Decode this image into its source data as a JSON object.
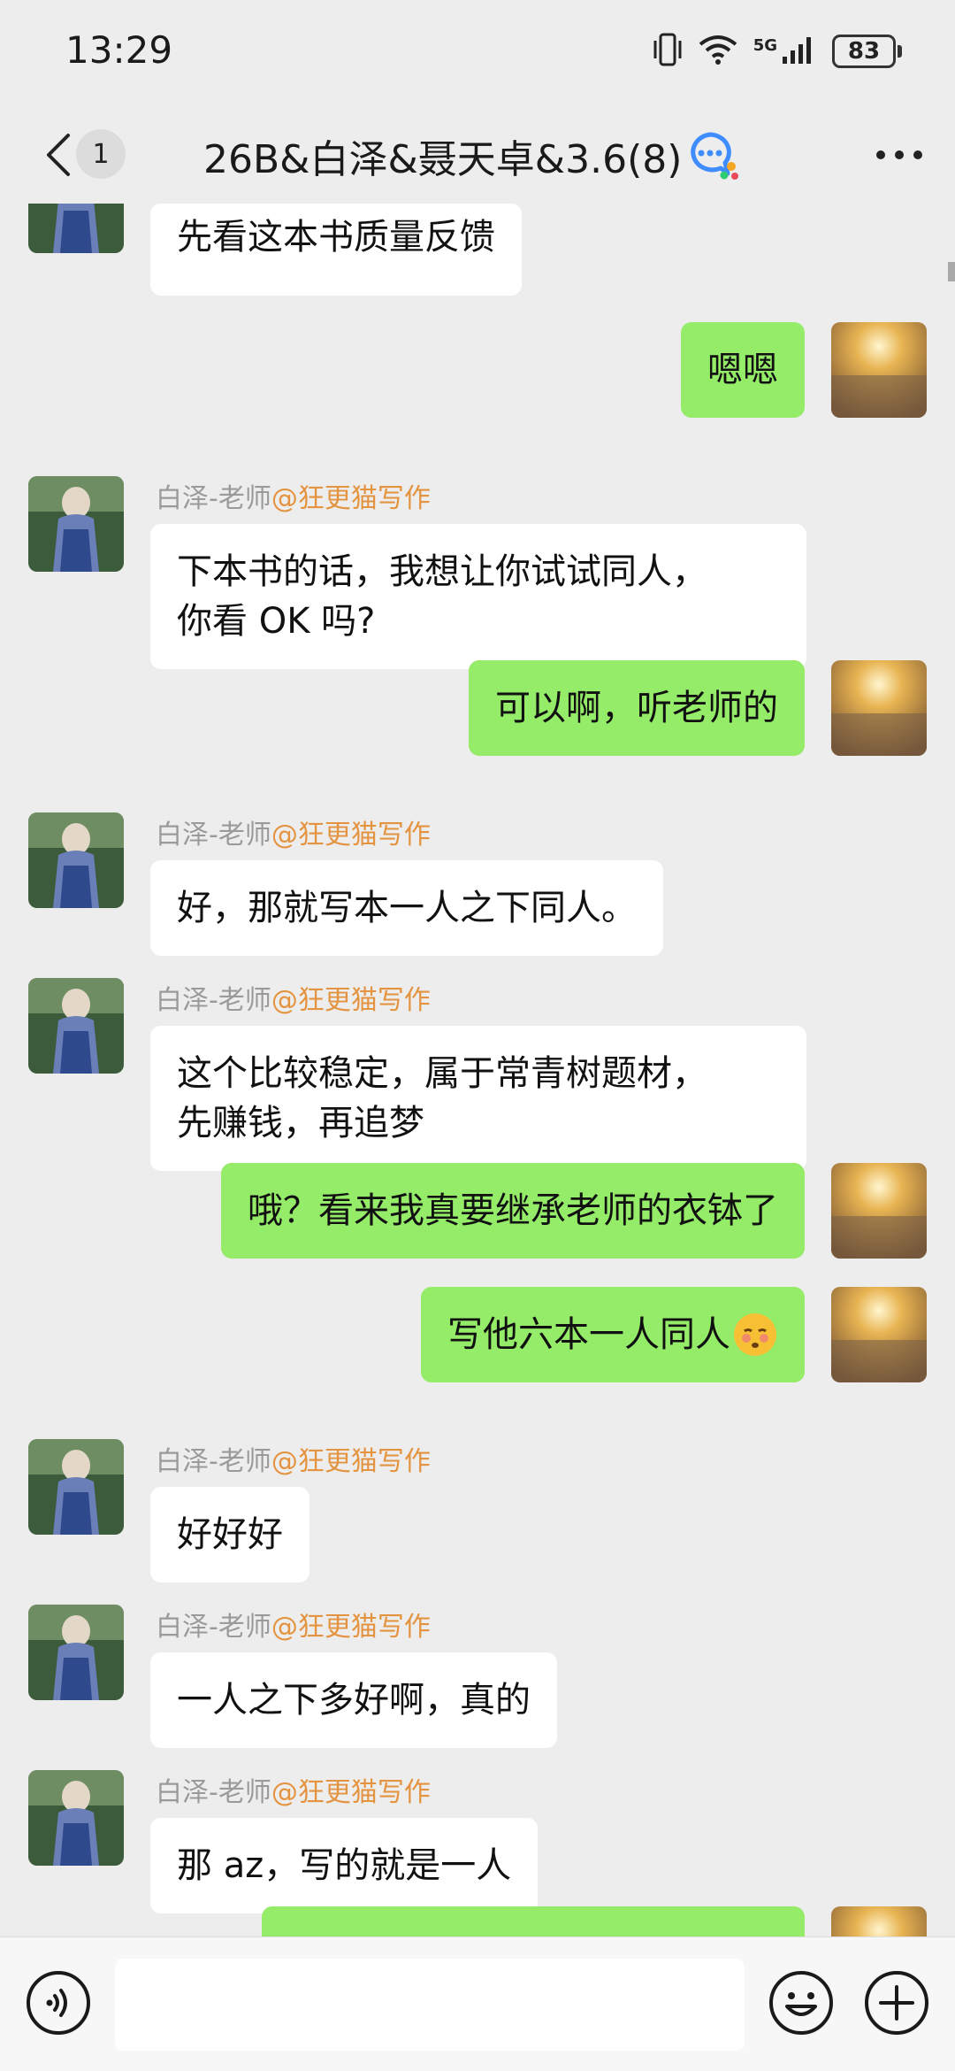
{
  "status_bar": {
    "time": "13:29",
    "network_label": "5G",
    "battery": "83",
    "icons": [
      "vibrate-icon",
      "wifi-icon",
      "signal-icon",
      "battery-icon"
    ]
  },
  "header": {
    "unread_count": "1",
    "title": "26B&白泽&聂天卓&3.6(8)",
    "icons": [
      "back-arrow-icon",
      "tencent-channel-icon",
      "more-icon"
    ]
  },
  "messages": [
    {
      "side": "left",
      "sender": "",
      "group": "",
      "lines": [
        "先看这本书质量反馈"
      ]
    },
    {
      "side": "right",
      "lines": [
        "嗯嗯"
      ]
    },
    {
      "side": "left",
      "sender": "白泽-老师",
      "group": "@狂更猫写作",
      "lines": [
        "下本书的话，我想让你试试同人，",
        "你看 OK 吗?"
      ]
    },
    {
      "side": "right",
      "lines": [
        "可以啊，听老师的"
      ]
    },
    {
      "side": "left",
      "sender": "白泽-老师",
      "group": "@狂更猫写作",
      "lines": [
        "好，那就写本一人之下同人。"
      ]
    },
    {
      "side": "left",
      "sender": "白泽-老师",
      "group": "@狂更猫写作",
      "lines": [
        "这个比较稳定，属于常青树题材，",
        "先赚钱，再追梦"
      ]
    },
    {
      "side": "right",
      "lines": [
        "哦？看来我真要继承老师的衣钵了"
      ]
    },
    {
      "side": "right",
      "lines": [
        "写他六本一人同人"
      ],
      "emoji": "shush-face-emoji"
    },
    {
      "side": "left",
      "sender": "白泽-老师",
      "group": "@狂更猫写作",
      "lines": [
        "好好好"
      ]
    },
    {
      "side": "left",
      "sender": "白泽-老师",
      "group": "@狂更猫写作",
      "lines": [
        "一人之下多好啊，真的"
      ]
    },
    {
      "side": "left",
      "sender": "白泽-老师",
      "group": "@狂更猫写作",
      "lines": [
        "那 az，写的就是一人"
      ]
    },
    {
      "side": "right",
      "lines": [
        ""
      ]
    }
  ],
  "input_bar": {
    "placeholder": "",
    "icons": [
      "voice-icon",
      "emoji-icon",
      "plus-icon"
    ]
  },
  "colors": {
    "background": "#ededed",
    "bubble_self": "#95ec69",
    "bubble_other": "#ffffff",
    "group_tag": "#e49440",
    "sender_name": "#9a9a9a"
  }
}
